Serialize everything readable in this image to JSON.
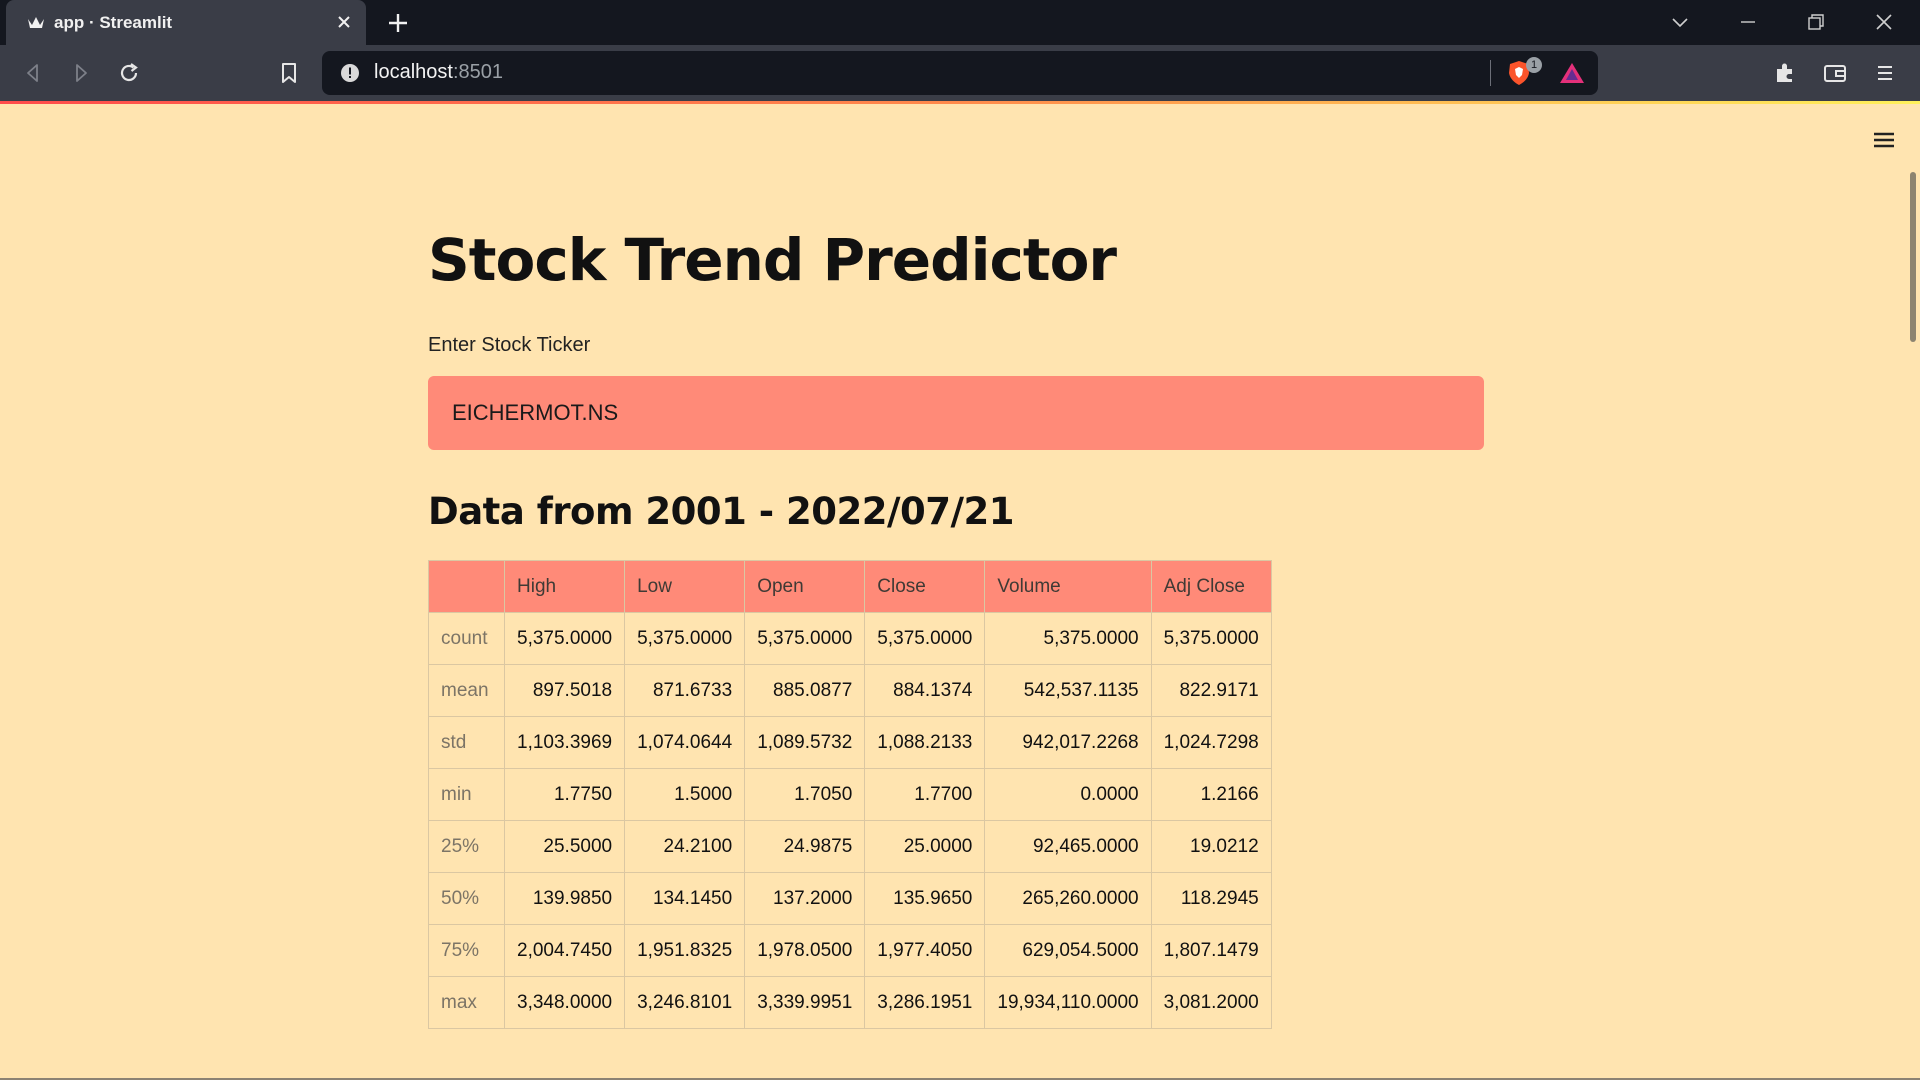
{
  "browser": {
    "tab_title": "app · Streamlit",
    "url_host": "localhost",
    "url_port": ":8501",
    "shield_badge": "1"
  },
  "app": {
    "title": "Stock Trend Predictor",
    "ticker_label": "Enter Stock Ticker",
    "ticker_value": "EICHERMOT.NS",
    "data_heading": "Data from 2001 - 2022/07/21"
  },
  "table": {
    "columns": [
      "",
      "High",
      "Low",
      "Open",
      "Close",
      "Volume",
      "Adj Close"
    ],
    "rows": [
      {
        "label": "count",
        "values": [
          "5,375.0000",
          "5,375.0000",
          "5,375.0000",
          "5,375.0000",
          "5,375.0000",
          "5,375.0000"
        ]
      },
      {
        "label": "mean",
        "values": [
          "897.5018",
          "871.6733",
          "885.0877",
          "884.1374",
          "542,537.1135",
          "822.9171"
        ]
      },
      {
        "label": "std",
        "values": [
          "1,103.3969",
          "1,074.0644",
          "1,089.5732",
          "1,088.2133",
          "942,017.2268",
          "1,024.7298"
        ]
      },
      {
        "label": "min",
        "values": [
          "1.7750",
          "1.5000",
          "1.7050",
          "1.7700",
          "0.0000",
          "1.2166"
        ]
      },
      {
        "label": "25%",
        "values": [
          "25.5000",
          "24.2100",
          "24.9875",
          "25.0000",
          "92,465.0000",
          "19.0212"
        ]
      },
      {
        "label": "50%",
        "values": [
          "139.9850",
          "134.1450",
          "137.2000",
          "135.9650",
          "265,260.0000",
          "118.2945"
        ]
      },
      {
        "label": "75%",
        "values": [
          "2,004.7450",
          "1,951.8325",
          "1,978.0500",
          "1,977.4050",
          "629,054.5000",
          "1,807.1479"
        ]
      },
      {
        "label": "max",
        "values": [
          "3,348.0000",
          "3,246.8101",
          "3,339.9951",
          "3,286.1951",
          "19,934,110.0000",
          "3,081.2000"
        ]
      }
    ]
  },
  "colors": {
    "page_bg": "#ffe4b0",
    "accent": "#ff8a78",
    "chrome_dark": "#14171f",
    "chrome_mid": "#3a3d47"
  }
}
